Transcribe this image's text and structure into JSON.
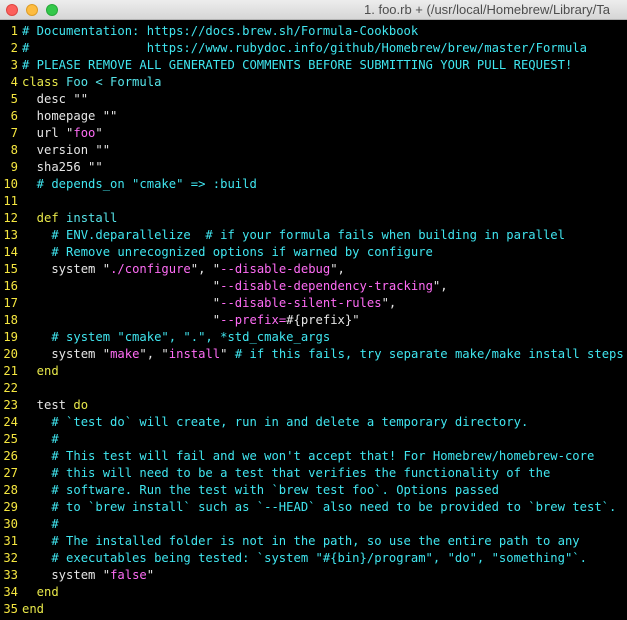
{
  "window": {
    "title": "1. foo.rb + (/usr/local/Homebrew/Library/Ta"
  },
  "colors": {
    "background": "#000000",
    "line_number": "#f5e640",
    "comment": "#40e6f0",
    "keyword": "#e8e84a",
    "definition": "#56e5ea",
    "string": "#ff6cf5",
    "text": "#e6e6e6"
  },
  "lines": [
    {
      "n": "1",
      "segs": [
        {
          "t": "# Documentation: https://docs.brew.sh/Formula-Cookbook",
          "c": "comment"
        }
      ]
    },
    {
      "n": "2",
      "segs": [
        {
          "t": "#                https://www.rubydoc.info/github/Homebrew/brew/master/Formula",
          "c": "comment"
        }
      ]
    },
    {
      "n": "3",
      "segs": [
        {
          "t": "# PLEASE REMOVE ALL GENERATED COMMENTS BEFORE SUBMITTING YOUR PULL REQUEST!",
          "c": "comment"
        }
      ]
    },
    {
      "n": "4",
      "segs": [
        {
          "t": "class",
          "c": "kw"
        },
        {
          "t": " Foo < Formula",
          "c": "def"
        }
      ]
    },
    {
      "n": "5",
      "segs": [
        {
          "t": "  desc \"\"",
          "c": "plain"
        }
      ]
    },
    {
      "n": "6",
      "segs": [
        {
          "t": "  homepage \"\"",
          "c": "plain"
        }
      ]
    },
    {
      "n": "7",
      "segs": [
        {
          "t": "  url \"",
          "c": "plain"
        },
        {
          "t": "foo",
          "c": "str"
        },
        {
          "t": "\"",
          "c": "plain"
        }
      ]
    },
    {
      "n": "8",
      "segs": [
        {
          "t": "  version \"\"",
          "c": "plain"
        }
      ]
    },
    {
      "n": "9",
      "segs": [
        {
          "t": "  sha256 \"\"",
          "c": "plain"
        }
      ]
    },
    {
      "n": "10",
      "segs": [
        {
          "t": "  # depends_on \"cmake\" => :build",
          "c": "comment"
        }
      ]
    },
    {
      "n": "11",
      "segs": []
    },
    {
      "n": "12",
      "segs": [
        {
          "t": "  def",
          "c": "kw"
        },
        {
          "t": " install",
          "c": "def"
        }
      ]
    },
    {
      "n": "13",
      "segs": [
        {
          "t": "    # ENV.deparallelize  # if your formula fails when building in parallel",
          "c": "comment"
        }
      ]
    },
    {
      "n": "14",
      "segs": [
        {
          "t": "    # Remove unrecognized options if warned by configure",
          "c": "comment"
        }
      ]
    },
    {
      "n": "15",
      "segs": [
        {
          "t": "    system \"",
          "c": "plain"
        },
        {
          "t": "./configure",
          "c": "str"
        },
        {
          "t": "\", \"",
          "c": "plain"
        },
        {
          "t": "--disable-debug",
          "c": "str"
        },
        {
          "t": "\",",
          "c": "plain"
        }
      ]
    },
    {
      "n": "16",
      "segs": [
        {
          "t": "                          \"",
          "c": "plain"
        },
        {
          "t": "--disable-dependency-tracking",
          "c": "str"
        },
        {
          "t": "\",",
          "c": "plain"
        }
      ]
    },
    {
      "n": "17",
      "segs": [
        {
          "t": "                          \"",
          "c": "plain"
        },
        {
          "t": "--disable-silent-rules",
          "c": "str"
        },
        {
          "t": "\",",
          "c": "plain"
        }
      ]
    },
    {
      "n": "18",
      "segs": [
        {
          "t": "                          \"",
          "c": "plain"
        },
        {
          "t": "--prefix=",
          "c": "str"
        },
        {
          "t": "#{prefix}\"",
          "c": "plain"
        }
      ]
    },
    {
      "n": "19",
      "segs": [
        {
          "t": "    # system \"cmake\", \".\", *std_cmake_args",
          "c": "comment"
        }
      ]
    },
    {
      "n": "20",
      "segs": [
        {
          "t": "    system \"",
          "c": "plain"
        },
        {
          "t": "make",
          "c": "str"
        },
        {
          "t": "\", \"",
          "c": "plain"
        },
        {
          "t": "install",
          "c": "str"
        },
        {
          "t": "\" ",
          "c": "plain"
        },
        {
          "t": "# if this fails, try separate make/make install steps",
          "c": "comment"
        }
      ]
    },
    {
      "n": "21",
      "segs": [
        {
          "t": "  end",
          "c": "kw"
        }
      ]
    },
    {
      "n": "22",
      "segs": []
    },
    {
      "n": "23",
      "segs": [
        {
          "t": "  test",
          "c": "plain"
        },
        {
          "t": " do",
          "c": "kw"
        }
      ]
    },
    {
      "n": "24",
      "segs": [
        {
          "t": "    # `test do` will create, run in and delete a temporary directory.",
          "c": "comment"
        }
      ]
    },
    {
      "n": "25",
      "segs": [
        {
          "t": "    #",
          "c": "comment"
        }
      ]
    },
    {
      "n": "26",
      "segs": [
        {
          "t": "    # This test will fail and we won't accept that! For Homebrew/homebrew-core",
          "c": "comment"
        }
      ]
    },
    {
      "n": "27",
      "segs": [
        {
          "t": "    # this will need to be a test that verifies the functionality of the",
          "c": "comment"
        }
      ]
    },
    {
      "n": "28",
      "segs": [
        {
          "t": "    # software. Run the test with `brew test foo`. Options passed",
          "c": "comment"
        }
      ]
    },
    {
      "n": "29",
      "segs": [
        {
          "t": "    # to `brew install` such as `--HEAD` also need to be provided to `brew test`.",
          "c": "comment"
        }
      ]
    },
    {
      "n": "30",
      "segs": [
        {
          "t": "    #",
          "c": "comment"
        }
      ]
    },
    {
      "n": "31",
      "segs": [
        {
          "t": "    # The installed folder is not in the path, so use the entire path to any",
          "c": "comment"
        }
      ]
    },
    {
      "n": "32",
      "segs": [
        {
          "t": "    # executables being tested: `system \"#{bin}/program\", \"do\", \"something\"`.",
          "c": "comment"
        }
      ]
    },
    {
      "n": "33",
      "segs": [
        {
          "t": "    system \"",
          "c": "plain"
        },
        {
          "t": "false",
          "c": "str"
        },
        {
          "t": "\"",
          "c": "plain"
        }
      ]
    },
    {
      "n": "34",
      "segs": [
        {
          "t": "  end",
          "c": "kw"
        }
      ]
    },
    {
      "n": "35",
      "segs": [
        {
          "t": "end",
          "c": "kw"
        }
      ]
    }
  ]
}
